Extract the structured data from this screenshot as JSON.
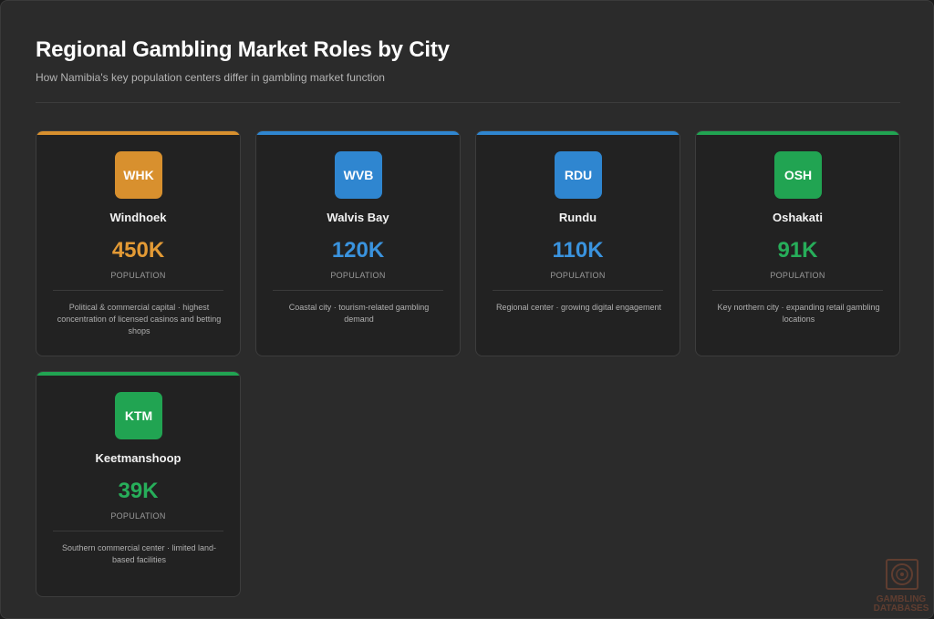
{
  "header": {
    "title": "Regional Gambling Market Roles by City",
    "subtitle": "How Namibia's key population centers differ in gambling market function"
  },
  "population_label": "POPULATION",
  "cities": [
    {
      "code": "WHK",
      "name": "Windhoek",
      "population": "450K",
      "color": "#d8902e",
      "description": "Political & commercial capital · highest concentration of licensed casinos and betting shops"
    },
    {
      "code": "WVB",
      "name": "Walvis Bay",
      "population": "120K",
      "color": "#2f86d0",
      "description": "Coastal city · tourism-related gambling demand"
    },
    {
      "code": "RDU",
      "name": "Rundu",
      "population": "110K",
      "color": "#2f86d0",
      "description": "Regional center · growing digital engagement"
    },
    {
      "code": "OSH",
      "name": "Oshakati",
      "population": "91K",
      "color": "#21a452",
      "description": "Key northern city · expanding retail gambling locations"
    },
    {
      "code": "KTM",
      "name": "Keetmanshoop",
      "population": "39K",
      "color": "#21a452",
      "description": "Southern commercial center · limited land-based facilities"
    }
  ],
  "watermark": {
    "line1": "GAMBLING",
    "line2": "DATABASES",
    "icon": "roulette-wheel-icon"
  }
}
